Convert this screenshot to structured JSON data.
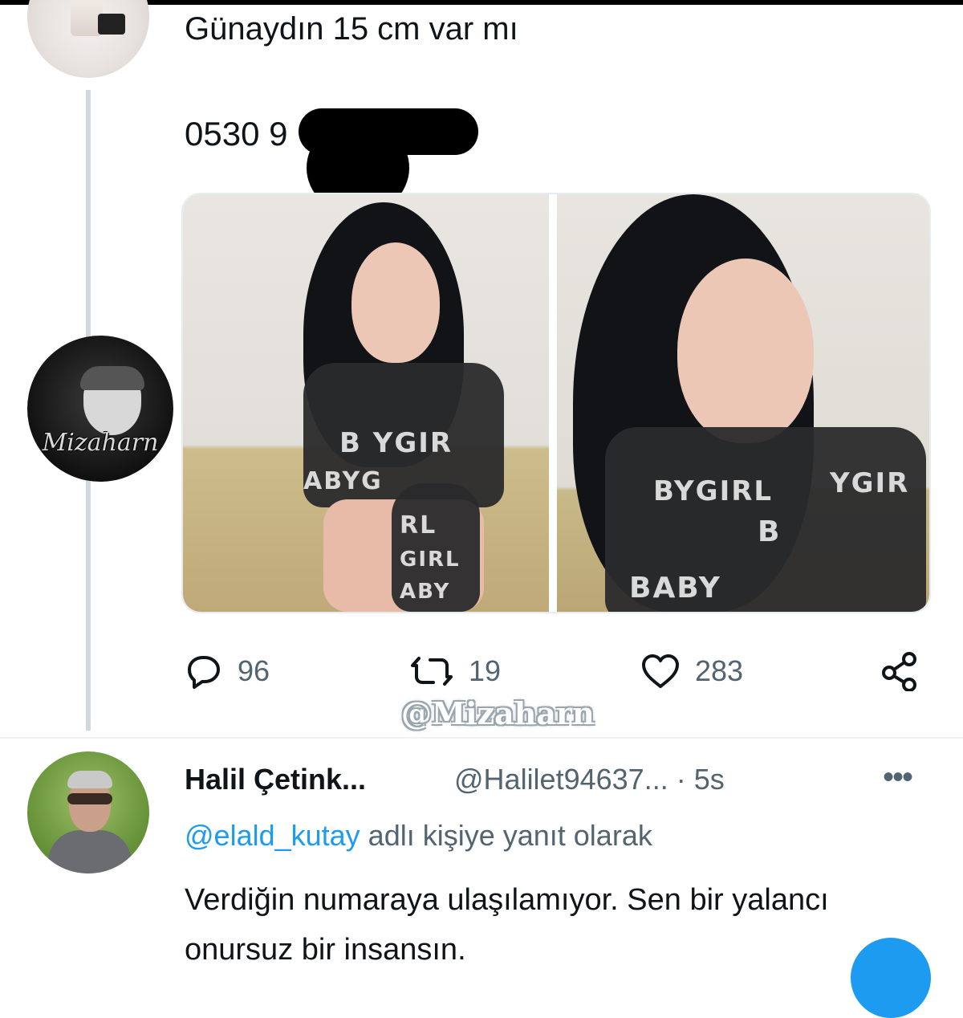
{
  "tweet": {
    "text": "Günaydın 15 cm var mı",
    "phone_visible": "0530 9",
    "stats": {
      "replies": "96",
      "retweets": "19",
      "likes": "283"
    }
  },
  "watermark": "@Mizaharn",
  "logo_avatar_text": "Mizaharn",
  "media": {
    "left_shirt_lines": [
      "B YGIR",
      "ABYG",
      "RL",
      "GIRL",
      "ABY"
    ],
    "right_shirt_lines": [
      "BYGIRL",
      "B",
      "BABY",
      "YGIR"
    ]
  },
  "reply": {
    "name": "Halil Çetink...",
    "handle_time": "@Halilet94637... · 5s",
    "more": "•••",
    "reply_to_mention": "@elald_kutay",
    "reply_to_suffix": " adlı kişiye yanıt olarak",
    "body": "Verdiğin numaraya ulaşılamıyor. Sen bir yalancı onursuz bir insansın."
  },
  "icons": {
    "reply": "comment-bubble-icon",
    "retweet": "retweet-icon",
    "like": "heart-icon",
    "share": "share-icon"
  },
  "colors": {
    "accent": "#1d9bf0",
    "muted": "#536471",
    "text": "#0f1419"
  }
}
